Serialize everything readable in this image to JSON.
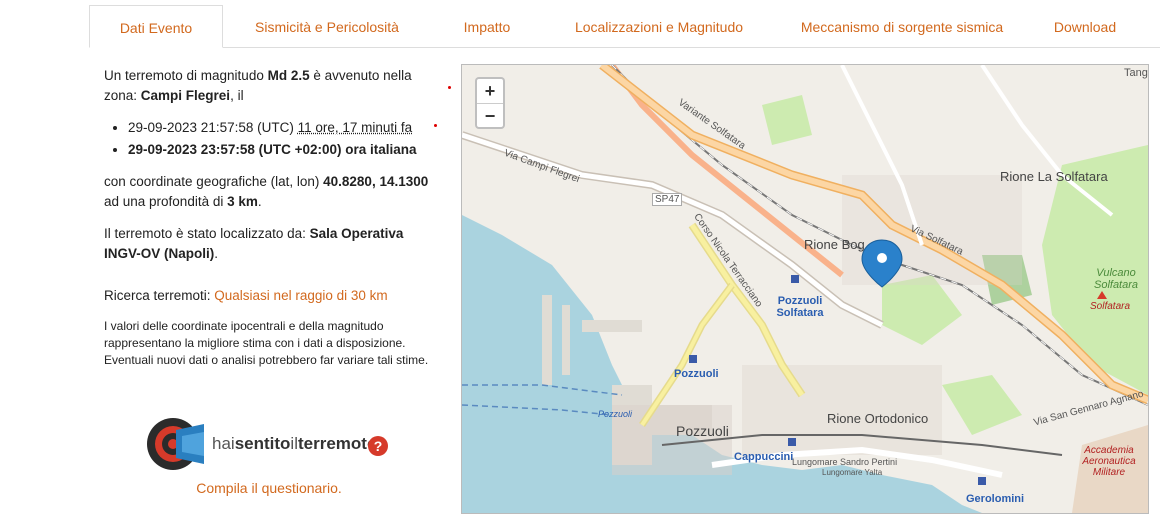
{
  "tabs": [
    {
      "label": "Dati Evento",
      "active": true
    },
    {
      "label": "Sismicità e Pericolosità"
    },
    {
      "label": "Impatto"
    },
    {
      "label": "Localizzazioni e Magnitudo"
    },
    {
      "label": "Meccanismo di sorgente sismica"
    },
    {
      "label": "Download"
    }
  ],
  "event": {
    "intro_1": "Un terremoto di magnitudo ",
    "magnitude": "Md 2.5",
    "intro_2": " è avvenuto nella zona: ",
    "zone": "Campi Flegrei",
    "intro_3": ", il",
    "utc_time": "29-09-2023 21:57:58 (UTC) ",
    "ago": "11 ore, 17 minuti fa",
    "local_time": "29-09-2023 23:57:58 (UTC +02:00) ora italiana",
    "coords_prefix": "con coordinate geografiche (lat, lon) ",
    "coords": "40.8280, 14.1300",
    "depth_prefix": " ad una profondità di ",
    "depth": "3 km",
    "depth_suffix": ".",
    "located_prefix": "Il terremoto è stato localizzato da: ",
    "located_by": "Sala Operativa INGV-OV (Napoli)",
    "located_suffix": ".",
    "search_prefix": "Ricerca terremoti: ",
    "search_link": "Qualsiasi nel raggio di 30 km",
    "note": "I valori delle coordinate ipocentrali e della magnitudo rappresentano la migliore stima con i dati a disposizione. Eventuali nuovi dati o analisi potrebbero far variare tali stime."
  },
  "hst": {
    "text_a": "hai",
    "text_b": "sentito",
    "text_c": "il",
    "text_d": "terremoto",
    "q": "?",
    "questionnaire": "Compila il questionario."
  },
  "map": {
    "zoom_in": "+",
    "zoom_out": "−",
    "labels": {
      "tang": "Tang",
      "rione_solfatara": "Rione La Solfatara",
      "rione_bog": "Rione Bog",
      "pozzuoli_solfatara": "Pozzuoli Solfatara",
      "pozzuoli_station": "Pozzuoli",
      "pozzuoli_town": "Pozzuoli",
      "rione_ortodonico": "Rione Ortodonico",
      "cappuccini": "Cappuccini",
      "vulcano": "Vulcano Solfatara",
      "solfatara": "Solfatara",
      "accademia": "Accademia Aeronautica Militare",
      "gerolomini": "Gerolomini",
      "sp47": "SP47",
      "via_campi_flegrei": "Via Campi Flegrei",
      "variante_solfatara": "Variante Solfatara",
      "via_solfatara": "Via Solfatara",
      "corso_nicola": "Corso Nicola Terracciano",
      "via_san_gennaro": "Via San Gennaro Agnano",
      "lungomare": "Lungomare Sandro Pertini",
      "lungomare_yalta": "Lungomare Yalta",
      "pozzuoli_port": "Pozzuoli"
    },
    "colors": {
      "water": "#aad3df",
      "land": "#f1eee8",
      "green": "#cdebb0",
      "road": "#fcd6a4",
      "primary": "#f8f0a0",
      "marker": "#2a81cb"
    }
  }
}
